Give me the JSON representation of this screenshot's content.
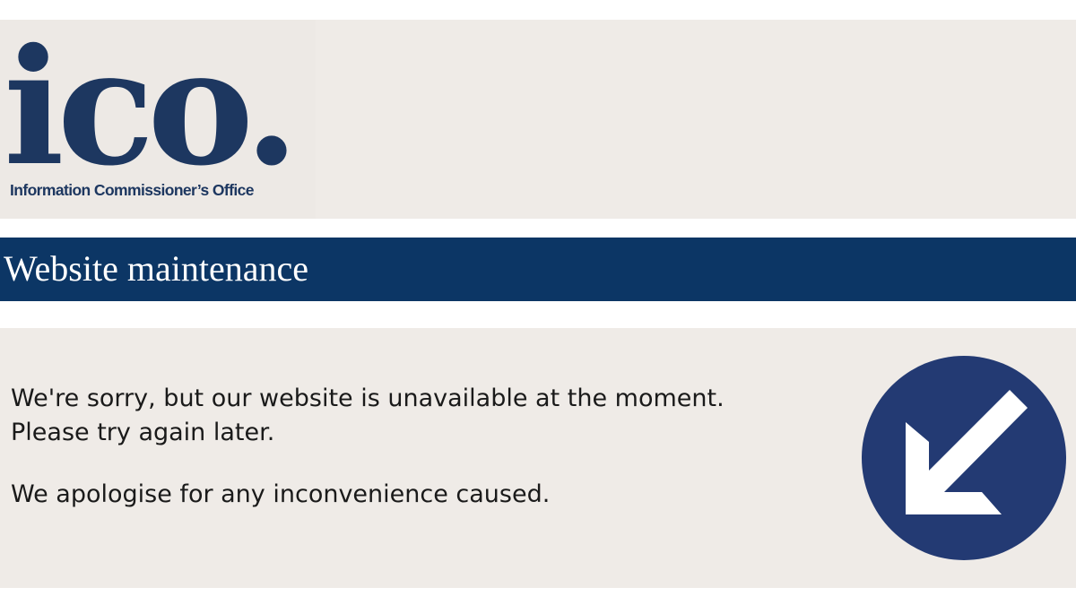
{
  "logo": {
    "wordmark": "ico.",
    "subtitle": "Information Commissioner’s Office",
    "color": "#1d3760"
  },
  "title_bar": {
    "title": "Website maintenance",
    "color": "#0c3665"
  },
  "content": {
    "message_line1": "We're sorry, but our website is unavailable at the moment.",
    "message_line2": "Please try again later.",
    "apology": "We apologise for any inconvenience caused.",
    "background": "#efebe7"
  },
  "icon": {
    "name": "arrow-down-left-icon",
    "color": "#233a73"
  }
}
